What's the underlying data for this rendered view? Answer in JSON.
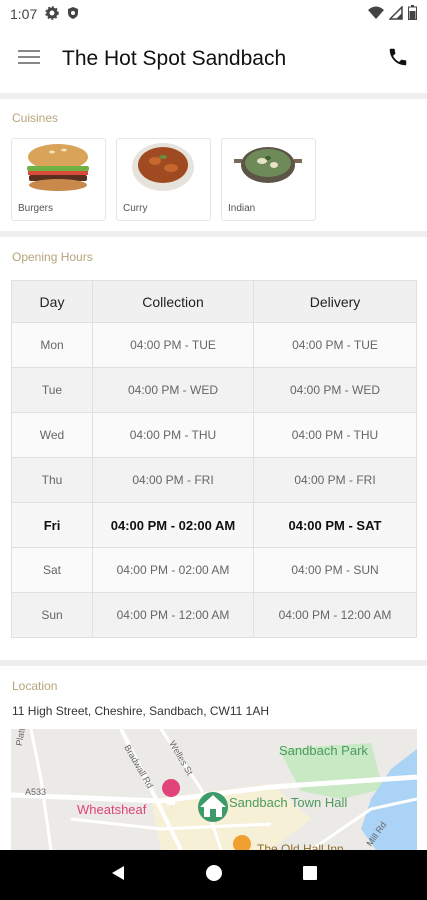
{
  "status": {
    "time": "1:07"
  },
  "app": {
    "title": "The Hot Spot Sandbach"
  },
  "cuisines": {
    "label": "Cuisines",
    "items": [
      {
        "name": "Burgers"
      },
      {
        "name": "Curry"
      },
      {
        "name": "Indian"
      }
    ]
  },
  "hours": {
    "label": "Opening Hours",
    "headers": [
      "Day",
      "Collection",
      "Delivery"
    ],
    "rows": [
      {
        "day": "Mon",
        "collection": "04:00 PM - TUE",
        "delivery": "04:00 PM - TUE"
      },
      {
        "day": "Tue",
        "collection": "04:00 PM - WED",
        "delivery": "04:00 PM - WED"
      },
      {
        "day": "Wed",
        "collection": "04:00 PM - THU",
        "delivery": "04:00 PM - THU"
      },
      {
        "day": "Thu",
        "collection": "04:00 PM - FRI",
        "delivery": "04:00 PM - FRI"
      },
      {
        "day": "Fri",
        "collection": "04:00 PM - 02:00 AM",
        "delivery": "04:00 PM - SAT"
      },
      {
        "day": "Sat",
        "collection": "04:00 PM - 02:00 AM",
        "delivery": "04:00 PM - SUN"
      },
      {
        "day": "Sun",
        "collection": "04:00 PM - 12:00 AM",
        "delivery": "04:00 PM - 12:00 AM"
      }
    ],
    "today_index": 4
  },
  "location": {
    "label": "Location",
    "address": "11 High Street, Cheshire, Sandbach, CW11 1AH",
    "map_labels": {
      "park": "Sandbach Park",
      "town_hall": "Sandbach Town Hall",
      "pub": "Wheatsheaf",
      "road_a533": "A533",
      "road_bradwall": "Bradwall Rd",
      "road_welles": "Welles St",
      "road_platt": "Platt Ave",
      "road_mill": "Mill Rd",
      "partial_label": "The Old Hall Inn"
    }
  },
  "colors": {
    "section_label": "#b6a47a",
    "divider": "#eeeeee",
    "map_green": "#c9e8c4",
    "map_water": "#aad3f5",
    "pub_pink": "#e0447a",
    "town_hall_green": "#3d9a6a"
  }
}
